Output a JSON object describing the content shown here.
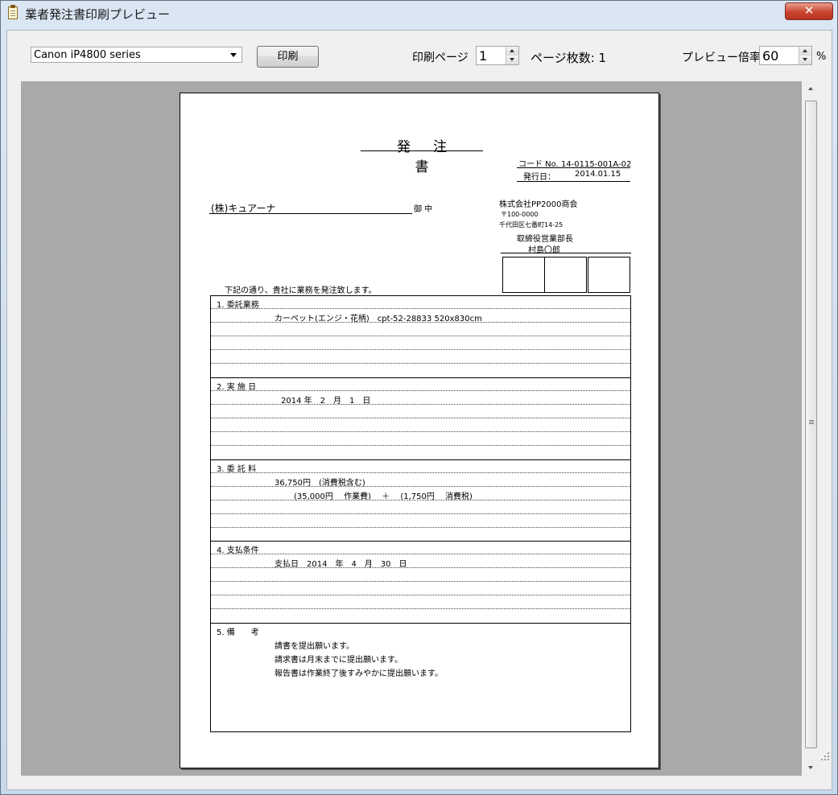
{
  "window": {
    "title": "業者発注書印刷プレビュー",
    "close_label": "✕"
  },
  "toolbar": {
    "printer": "Canon iP4800 series",
    "print_button": "印刷",
    "print_page_label": "印刷ページ",
    "print_page_value": "1",
    "page_count_label": "ページ枚数: 1",
    "zoom_label": "プレビュー倍率",
    "zoom_value": "60",
    "zoom_unit": "%"
  },
  "document": {
    "title": "発注書",
    "code": "コード No. 14-0115-001A-02",
    "issue_date_label": "発行日：",
    "issue_date": "2014.01.15",
    "recipient": "(株)キュアーナ",
    "honorific": "御 中",
    "sender_company": "株式会社PP2000商会",
    "sender_zip": "〒100-0000",
    "sender_address": "千代田区七番町14-25",
    "sender_title": "取締役営業部長",
    "sender_name": "村島〇郎",
    "intro": "下記の通り、貴社に業務を発注致します。",
    "sections": {
      "s1": {
        "heading": "1. 委託業務",
        "line1": "カーペット(エンジ・花柄)　cpt-52-28833 520x830cm"
      },
      "s2": {
        "heading": "2. 実 施 日",
        "line1": "2014 年　2　月　1　日"
      },
      "s3": {
        "heading": "3. 委 託 料",
        "line1": "36,750円　(消費税含む)",
        "line2": "(35,000円　 作業費)　 ＋　 (1,750円　 消費税)"
      },
      "s4": {
        "heading": "4. 支払条件",
        "line1": "支払日　2014　年　4　月　30　日"
      },
      "s5": {
        "heading": "5. 備　　考",
        "line1": "請書を提出願います。",
        "line2": "請求書は月末までに提出願います。",
        "line3": "報告書は作業終了後すみやかに提出願います。"
      }
    }
  },
  "icons": {
    "app": "clipboard-icon",
    "close": "close-icon",
    "dropdown": "chevron-down-icon",
    "spin_up": "spin-up-icon",
    "spin_down": "spin-down-icon",
    "scroll_up": "scroll-up-icon",
    "scroll_down": "scroll-down-icon"
  }
}
